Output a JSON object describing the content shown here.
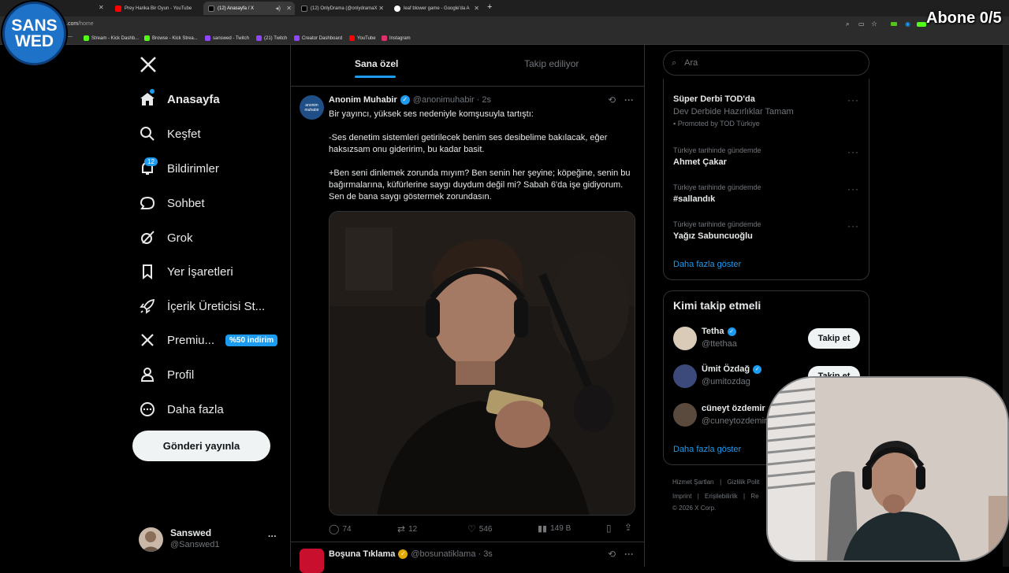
{
  "browser": {
    "tabs": [
      {
        "label": "Prey Harika Bir Oyun - YouTube",
        "fav_color": "#ff0000"
      },
      {
        "label": "(12) Anasayfa / X",
        "fav_color": "#000000"
      },
      {
        "label": "(12) OnlyDrama (@onlydramaX",
        "fav_color": "#000000"
      },
      {
        "label": "leaf blower game - Google'da A",
        "fav_color": "#4285f4"
      }
    ],
    "new_tab": "+",
    "url_domain": ".com",
    "url_path": "/home",
    "bookmarks": [
      {
        "label": "Stream - Kick Dashb...",
        "color": "#53fc18"
      },
      {
        "label": "Browse - Kick Strea...",
        "color": "#53fc18"
      },
      {
        "label": "sanswed - Twitch",
        "color": "#9146ff"
      },
      {
        "label": "(21) Twitch",
        "color": "#9146ff"
      },
      {
        "label": "Creator Dashboard",
        "color": "#9146ff"
      },
      {
        "label": "YouTube",
        "color": "#ff0000"
      },
      {
        "label": "Instagram",
        "color": "#e1306c"
      }
    ]
  },
  "overlay": {
    "logo_line1": "SANS",
    "logo_line2": "WED",
    "abone": "Abone 0/5"
  },
  "nav": {
    "items": [
      {
        "label": "Anasayfa",
        "icon": "home-icon"
      },
      {
        "label": "Keşfet",
        "icon": "search-icon"
      },
      {
        "label": "Bildirimler",
        "icon": "bell-icon"
      },
      {
        "label": "Sohbet",
        "icon": "chat-icon"
      },
      {
        "label": "Grok",
        "icon": "grok-icon"
      },
      {
        "label": "Yer İşaretleri",
        "icon": "bookmark-icon"
      },
      {
        "label": "İçerik Üreticisi St...",
        "icon": "rocket-icon"
      },
      {
        "label": "Premiu...",
        "icon": "x-logo-icon"
      },
      {
        "label": "Profil",
        "icon": "person-icon"
      },
      {
        "label": "Daha fazla",
        "icon": "more-circle-icon"
      }
    ],
    "notifications_badge": "12",
    "premium_promo": "%50 indirim",
    "post_button": "Gönderi yayınla",
    "account_name": "Sanswed",
    "account_handle": "@Sanswed1",
    "account_more": "···"
  },
  "main": {
    "tabs": [
      "Sana özel",
      "Takip ediliyor"
    ],
    "tweet": {
      "author": "Anonim Muhabir",
      "handle": "@anonimuhabir",
      "time": "· 2s",
      "avatar_text": "anonim muhabir",
      "line1": "Bir yayıncı, yüksek ses nedeniyle komşusuyla tartıştı:",
      "para2": "-Ses denetim sistemleri getirilecek benim ses desibelime bakılacak, eğer haksızsam onu gideririm, bu kadar basit.",
      "para3": "+Ben seni dinlemek zorunda mıyım? Ben senin her şeyine; köpeğine, senin bu bağırmalarına, küfürlerine saygı duydum değil mi? Sabah 6'da işe gidiyorum. Sen de bana saygı göstermek zorundasın.",
      "replies": "74",
      "reposts": "12",
      "likes": "546",
      "views": "149 B"
    },
    "tweet2": {
      "author": "Boşuna Tıklama",
      "handle": "@bosunatiklama",
      "time": "· 3s"
    }
  },
  "right": {
    "search_placeholder": "Ara",
    "trends": [
      {
        "title": "Süper Derbi TOD'da",
        "desc": "Dev Derbide Hazırlıklar Tamam",
        "promo": "Promoted by TOD Türkiye"
      },
      {
        "context": "Türkiye tarihinde gündemde",
        "title": "Ahmet Çakar"
      },
      {
        "context": "Türkiye tarihinde gündemde",
        "title": "#sallandık"
      },
      {
        "context": "Türkiye tarihinde gündemde",
        "title": "Yağız Sabuncuoğlu"
      }
    ],
    "show_more": "Daha fazla göster",
    "who_to_follow_title": "Kimi takip etmeli",
    "follow_suggestions": [
      {
        "name": "Tetha",
        "handle": "@ttethaa",
        "button": "Takip et"
      },
      {
        "name": "Ümit Özdağ",
        "handle": "@umitozdag",
        "button": "Takip et"
      },
      {
        "name": "cüneyt özdemir",
        "handle": "@cuneytozdemir",
        "button": ""
      }
    ],
    "show_more_2": "Daha fazla göster",
    "footer_line1": [
      "Hizmet Şartları",
      "|",
      "Gizlilik Polit"
    ],
    "footer_line2": [
      "Imprint",
      "|",
      "Erişilebilirlik",
      "|",
      "Re"
    ],
    "copyright": "© 2026 X Corp."
  }
}
